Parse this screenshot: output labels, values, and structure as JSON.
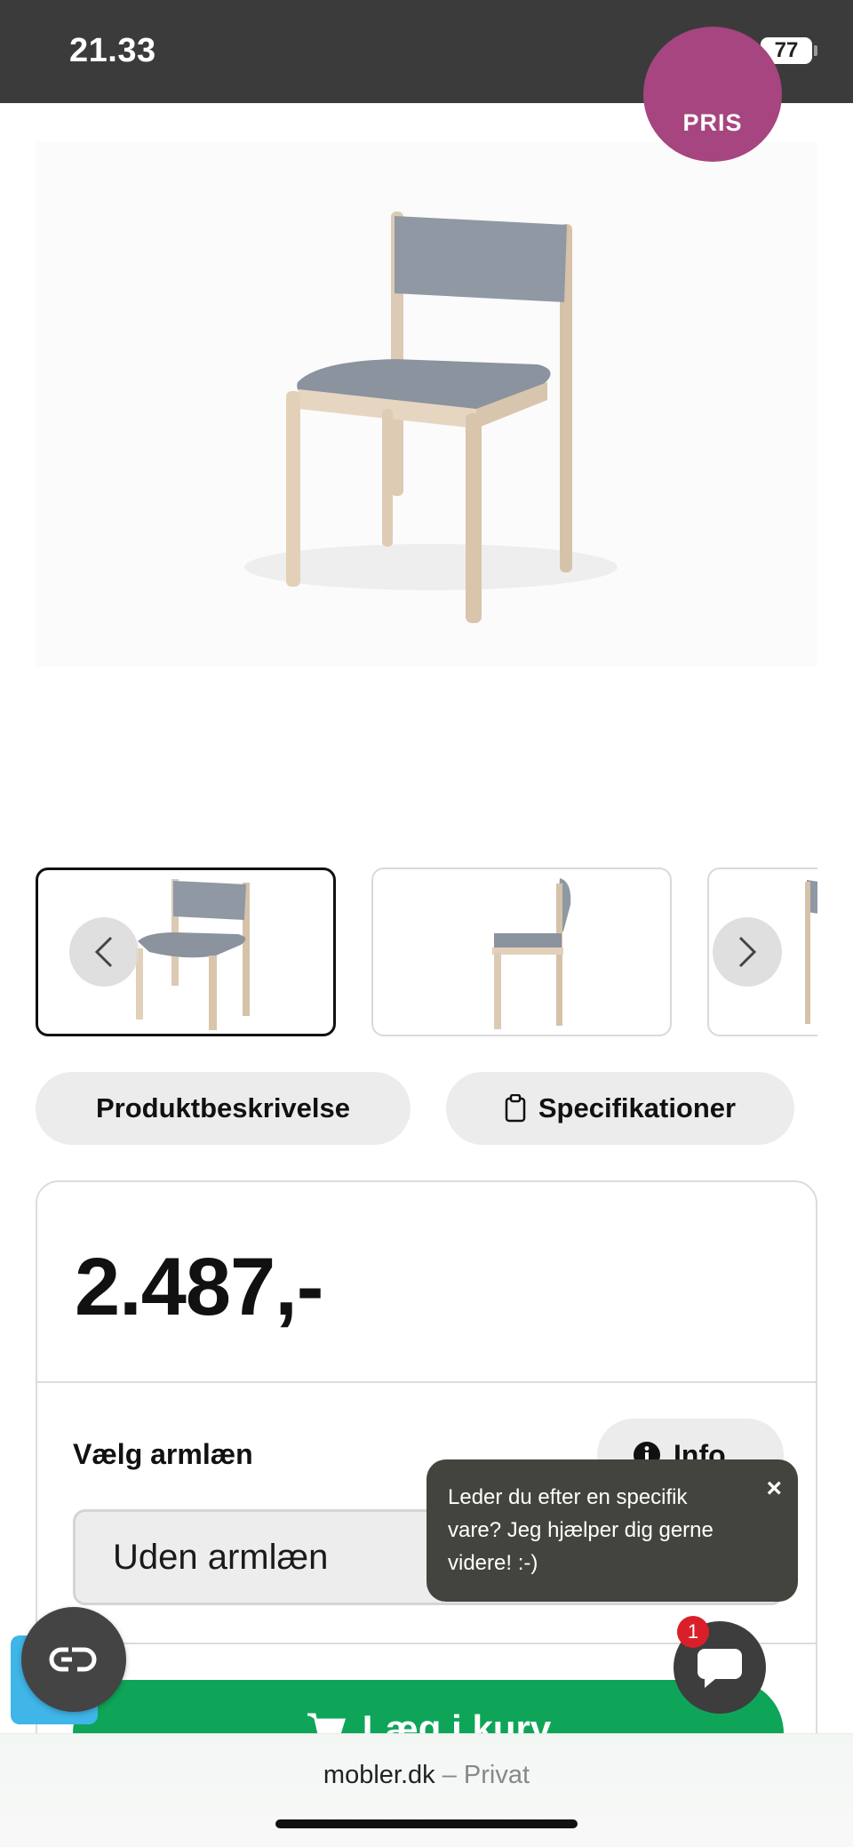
{
  "status_bar": {
    "time": "21.33",
    "battery": "77"
  },
  "badge": {
    "label": "PRIS"
  },
  "product": {
    "image_alt": "Chair with grey upholstered seat and back, light wood frame",
    "thumbnails": [
      "chair-front",
      "chair-side",
      "chair-partial"
    ]
  },
  "tabs": {
    "description": "Produktbeskrivelse",
    "specifications": "Specifikationer"
  },
  "price_card": {
    "price": "2.487,-",
    "option_label": "Vælg armlæn",
    "info_label": "Info",
    "selected_option": "Uden armlæn",
    "cart_label": "Læg i kurv"
  },
  "chat": {
    "message": "Leder du efter en specifik vare? Jeg hjælper dig gerne videre! :-)",
    "close": "×",
    "unread_count": "1"
  },
  "browser": {
    "domain": "mobler.dk",
    "separator": "–",
    "mode": "Privat"
  },
  "colors": {
    "badge": "#a6457f",
    "cart_button": "#0fa559",
    "chat_bubble": "#44443f",
    "status_bar": "#3b3b3b"
  }
}
